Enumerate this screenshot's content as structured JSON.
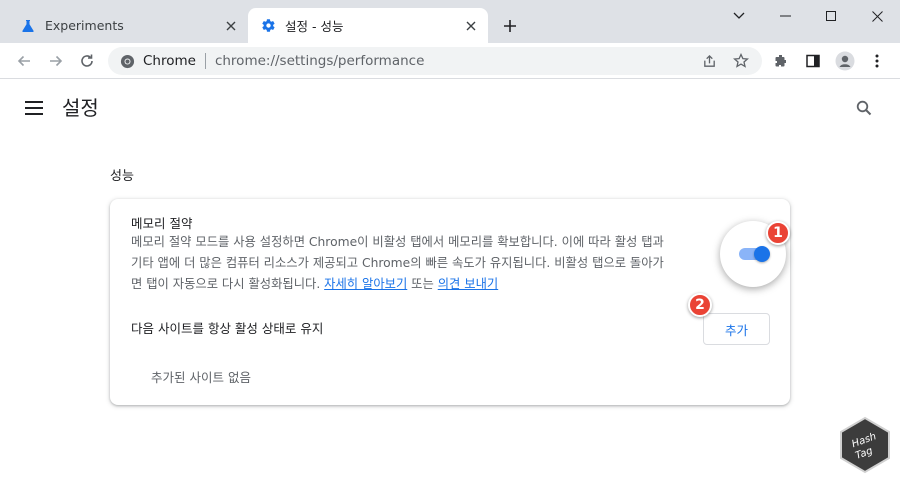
{
  "tabs": [
    {
      "title": "Experiments",
      "active": false,
      "icon": "flask-icon"
    },
    {
      "title": "설정 - 성능",
      "active": true,
      "icon": "gear-icon"
    }
  ],
  "toolbar": {
    "scheme": "Chrome",
    "url": "chrome://settings/performance"
  },
  "page": {
    "title": "설정",
    "section_title": "성능"
  },
  "memory_saver": {
    "title": "메모리 절약",
    "description_lines": [
      "메모리 절약 모드를 사용 설정하면 Chrome이 비활성 탭에서 메모리를 확보합니다. 이에 따라 활성 탭과",
      "기타 앱에 더 많은 컴퓨터 리소스가 제공되고 Chrome의 빠른 속도가 유지됩니다. 비활성 탭으로 돌아가"
    ],
    "description_line3_prefix": "면 탭이 자동으로 다시 활성화됩니다. ",
    "learn_more_link": "자세히 알아보기",
    "or_text": " 또는 ",
    "feedback_link": "의견 보내기",
    "enabled": true,
    "keep_active_label": "다음 사이트를 항상 활성 상태로 유지",
    "add_button": "추가",
    "no_sites_text": "추가된 사이트 없음"
  },
  "annotations": {
    "badge1": "1",
    "badge2": "2"
  },
  "watermark": {
    "line1": "Hash",
    "line2": "Tag"
  },
  "colors": {
    "accent": "#1a73e8",
    "badge": "#ea4335"
  }
}
